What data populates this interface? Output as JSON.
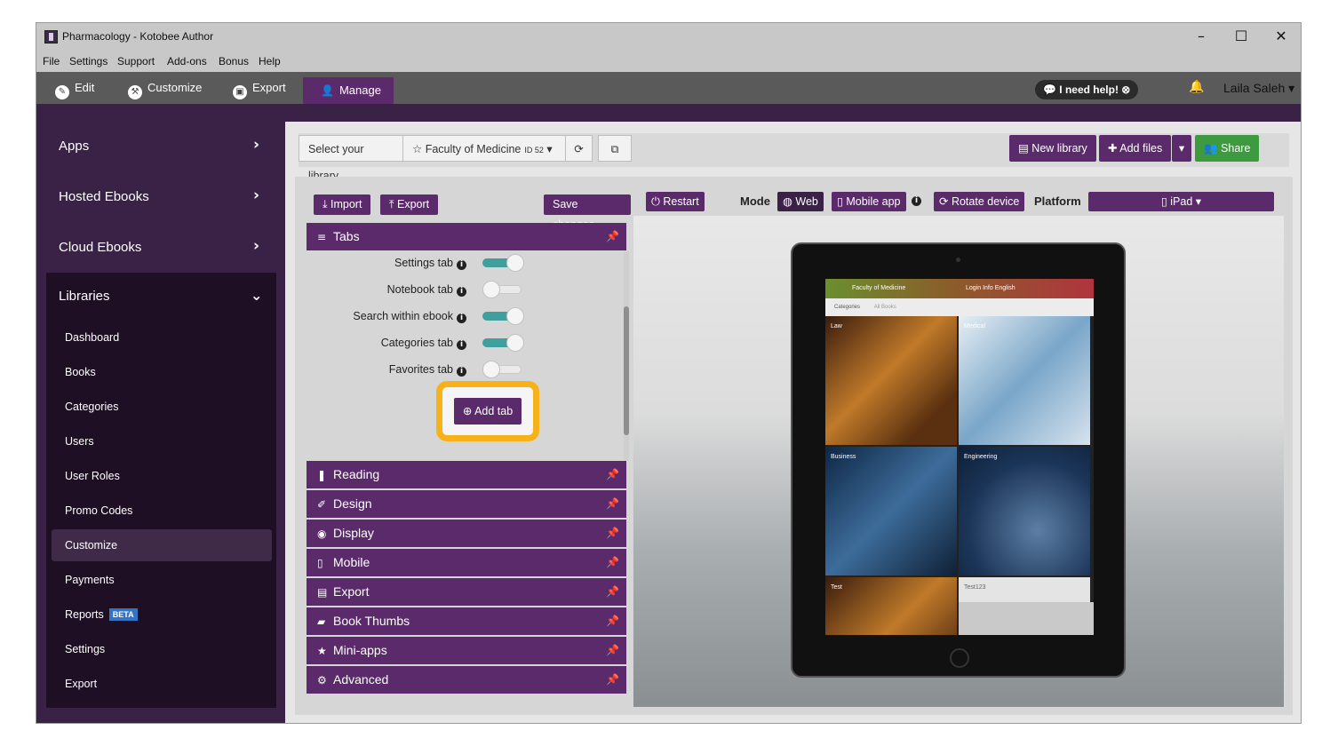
{
  "window": {
    "title": "Pharmacology - Kotobee Author",
    "controls": [
      "–",
      "☐",
      "✕"
    ]
  },
  "menubar": [
    "File",
    "Settings",
    "Support",
    "Add-ons",
    "Bonus",
    "Help"
  ],
  "toolbar": {
    "tabs": [
      {
        "label": "Edit",
        "icon": "pencil-icon",
        "glyph": "✎"
      },
      {
        "label": "Customize",
        "icon": "wrench-icon",
        "glyph": "⚒"
      },
      {
        "label": "Export",
        "icon": "export-icon",
        "glyph": "▣"
      }
    ],
    "active_tab": {
      "label": "Manage",
      "icon": "user-icon",
      "glyph": "👤"
    },
    "help_label": "I need help!",
    "user_name": "Laila Saleh"
  },
  "sidebar": {
    "sections": [
      "Apps",
      "Hosted Ebooks",
      "Cloud Ebooks"
    ],
    "libraries": {
      "title": "Libraries",
      "items": [
        "Dashboard",
        "Books",
        "Categories",
        "Users",
        "User Roles",
        "Promo Codes",
        "Customize",
        "Payments",
        "Reports",
        "Settings",
        "Export"
      ],
      "active": "Customize",
      "badge": "BETA"
    }
  },
  "library_bar": {
    "select_label": "Select your library",
    "library_name": "Faculty of Medicine",
    "library_id": "ID 52",
    "new_library": "New library",
    "add_files": "Add files",
    "share": "Share"
  },
  "panel": {
    "import_label": "Import",
    "export_label": "Export",
    "save_label": "Save changes",
    "tabs_header": "Tabs",
    "tab_options": [
      {
        "label": "Settings tab",
        "on": true
      },
      {
        "label": "Notebook tab",
        "on": false
      },
      {
        "label": "Search within ebook",
        "on": true
      },
      {
        "label": "Categories tab",
        "on": true
      },
      {
        "label": "Favorites tab",
        "on": false
      }
    ],
    "add_tab_label": "Add tab",
    "sections": [
      {
        "label": "Reading",
        "icon": "bookmark-icon",
        "glyph": "❚"
      },
      {
        "label": "Design",
        "icon": "brush-icon",
        "glyph": "✐"
      },
      {
        "label": "Display",
        "icon": "eye-icon",
        "glyph": "◉"
      },
      {
        "label": "Mobile",
        "icon": "mobile-icon",
        "glyph": "▯"
      },
      {
        "label": "Export",
        "icon": "pdf-icon",
        "glyph": "▤"
      },
      {
        "label": "Book Thumbs",
        "icon": "book-icon",
        "glyph": "▰"
      },
      {
        "label": "Mini-apps",
        "icon": "star-icon",
        "glyph": "★"
      },
      {
        "label": "Advanced",
        "icon": "cog-icon",
        "glyph": "⚙"
      }
    ]
  },
  "preview": {
    "restart": "Restart",
    "mode_label": "Mode",
    "mode_web": "Web",
    "mode_mobile": "Mobile app",
    "rotate": "Rotate device",
    "platform_label": "Platform",
    "platform_value": "iPad",
    "screen": {
      "title": "Faculty of Medicine",
      "nav_right": "Login   Info   English",
      "tab_categories": "Categories",
      "tab_all": "All Books",
      "tiles": [
        "Law",
        "Medical",
        "Business",
        "Engineering",
        "Test",
        "Test123"
      ]
    }
  }
}
